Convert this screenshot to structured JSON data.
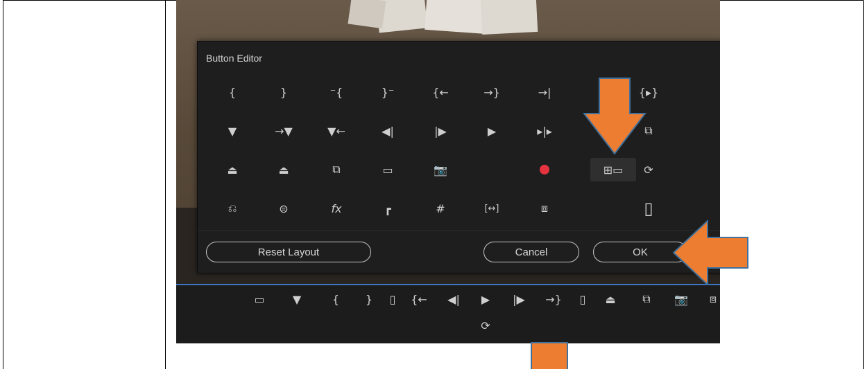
{
  "dialog": {
    "title": "Button Editor",
    "reset_label": "Reset Layout",
    "cancel_label": "Cancel",
    "ok_label": "OK"
  },
  "icons": {
    "row1": [
      "{",
      "}",
      "⁻{",
      "}⁻",
      "{←",
      "→}",
      "→|",
      "",
      "{▸}"
    ],
    "row2": [
      "▼",
      "→▼",
      "▼←",
      "◀|",
      "|▶",
      "▶",
      "▸|▸",
      "",
      "⧉"
    ],
    "row3": [
      "⏏",
      "⏏",
      "⧉",
      "▭",
      "📷",
      "",
      "●",
      "⊞▭",
      "⟳"
    ],
    "row4": [
      "⎌",
      "⊜",
      "fx",
      "┏",
      "#",
      "[↔]",
      "⧈",
      "",
      "▯"
    ]
  },
  "transport": {
    "row1": [
      "▭",
      "▼",
      "{",
      "}",
      "▯",
      "{←",
      "◀|",
      "▶",
      "|▶",
      "→}",
      "▯",
      "⏏",
      "⧉",
      "📷",
      "⧈"
    ],
    "row2": [
      "⟳"
    ]
  },
  "colors": {
    "arrow": "#ed7d31",
    "arrow_border": "#41719c",
    "record": "#e5343f",
    "timeline_line": "#3a78c7"
  }
}
